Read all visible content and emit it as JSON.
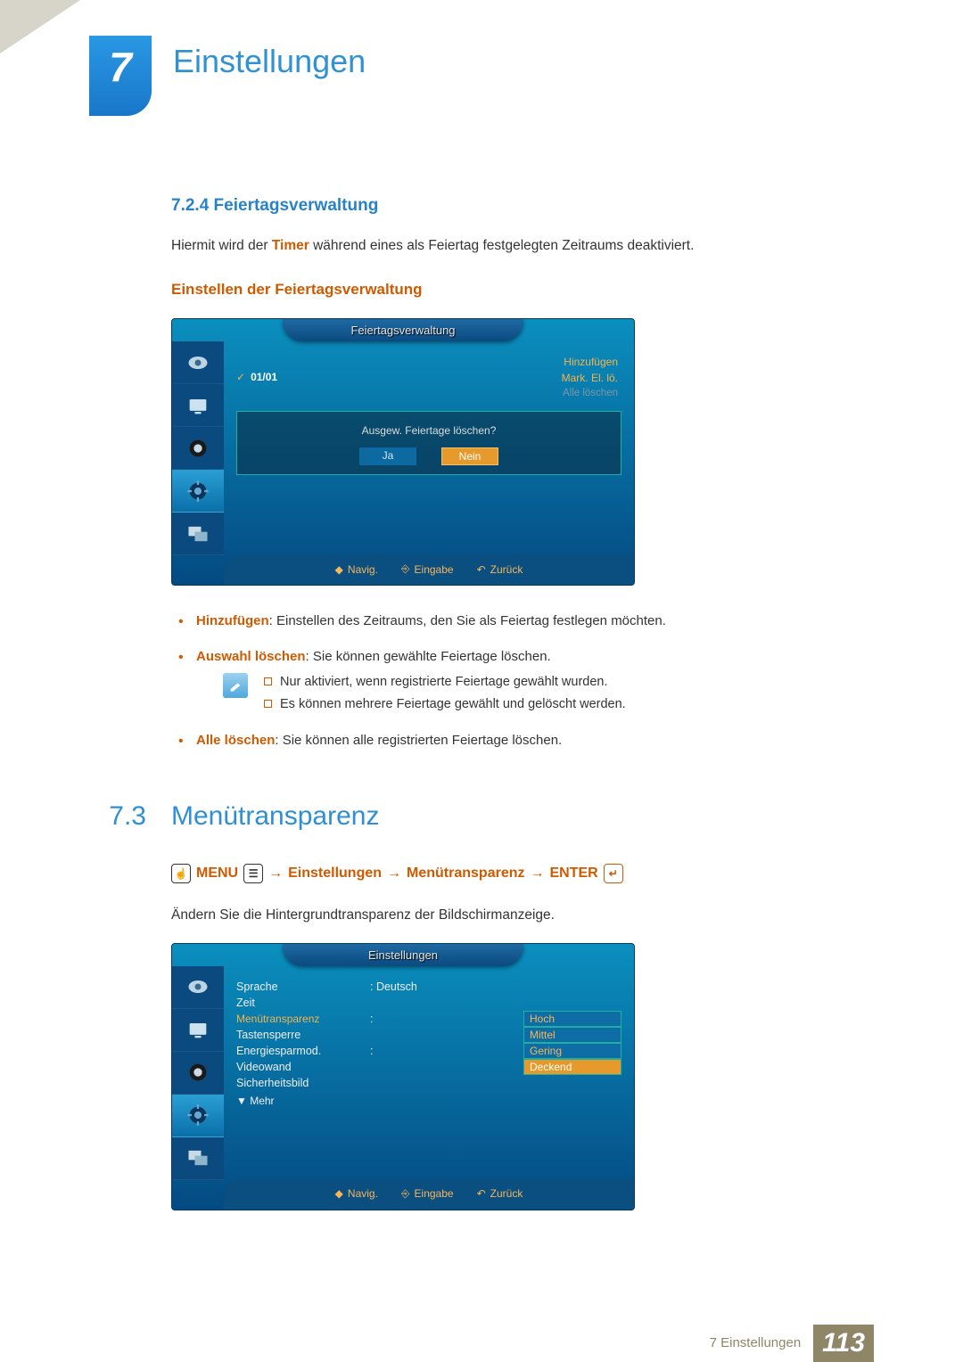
{
  "chapter": {
    "number": "7",
    "title": "Einstellungen"
  },
  "s724": {
    "num": "7.2.4",
    "title": "Feiertagsverwaltung",
    "intro_pre": "Hiermit wird der ",
    "intro_bold": "Timer",
    "intro_post": " während eines als Feiertag festgelegten Zeitraums deaktiviert.",
    "subhead": "Einstellen der Feiertagsverwaltung"
  },
  "osd1": {
    "title": "Feiertagsverwaltung",
    "entry": "01/01",
    "actions": {
      "add": "Hinzufügen",
      "delsel": "Mark. El. lö.",
      "delall": "Alle löschen"
    },
    "confirm_q": "Ausgew. Feiertage löschen?",
    "yes": "Ja",
    "no": "Nein",
    "nav": {
      "navig": "Navig.",
      "enter": "Eingabe",
      "back": "Zurück"
    }
  },
  "bullets": {
    "b1_t": "Hinzufügen",
    "b1_d": ": Einstellen des Zeitraums, den Sie als Feiertag festlegen möchten.",
    "b2_t": "Auswahl löschen",
    "b2_d": ": Sie können gewählte Feiertage löschen.",
    "note1": "Nur aktiviert, wenn registrierte Feiertage gewählt wurden.",
    "note2": "Es können mehrere Feiertage gewählt und gelöscht werden.",
    "b3_t": "Alle löschen",
    "b3_d": ": Sie können alle registrierten Feiertage löschen."
  },
  "s73": {
    "idx": "7.3",
    "title": "Menütransparenz",
    "path": {
      "menu": "MENU",
      "arrow": "→",
      "p1": "Einstellungen",
      "p2": "Menütransparenz",
      "enter": "ENTER"
    },
    "desc": "Ändern Sie die Hintergrundtransparenz der Bildschirmanzeige."
  },
  "osd2": {
    "title": "Einstellungen",
    "rows": {
      "sprache_l": "Sprache",
      "sprache_v": ": Deutsch",
      "zeit_l": "Zeit",
      "menutr_l": "Menütransparenz",
      "menutr_v": ":",
      "taste_l": "Tastensperre",
      "energie_l": "Energiesparmod.",
      "energie_v": ": ",
      "video_l": "Videowand",
      "sicher_l": "Sicherheitsbild"
    },
    "opts": {
      "hoch": "Hoch",
      "mittel": "Mittel",
      "gering": "Gering",
      "deckend": "Deckend"
    },
    "mehr": "▼ Mehr",
    "nav": {
      "navig": "Navig.",
      "enter": "Eingabe",
      "back": "Zurück"
    }
  },
  "footer": {
    "chapter": "7 Einstellungen",
    "page": "113"
  }
}
